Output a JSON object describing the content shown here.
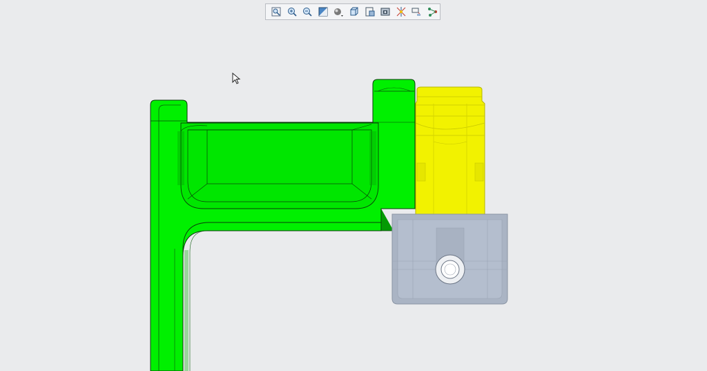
{
  "toolbar": {
    "buttons": [
      {
        "name": "refit-icon"
      },
      {
        "name": "zoom-in-icon"
      },
      {
        "name": "zoom-out-icon"
      },
      {
        "name": "repaint-icon"
      },
      {
        "name": "display-style-icon"
      },
      {
        "name": "saved-orientations-icon"
      },
      {
        "name": "view-manager-icon"
      },
      {
        "name": "section-icon"
      },
      {
        "name": "datum-display-icon"
      },
      {
        "name": "annotation-display-icon"
      },
      {
        "name": "spin-center-icon"
      }
    ]
  },
  "colors": {
    "background": "#eaebed",
    "green_part": "#00f000",
    "yellow_part": "#f2f200",
    "gray_part": "#aab4c4",
    "edge": "#0a3a0a"
  },
  "model": {
    "parts": [
      "green-bracket",
      "yellow-cylinder",
      "gray-block"
    ]
  }
}
